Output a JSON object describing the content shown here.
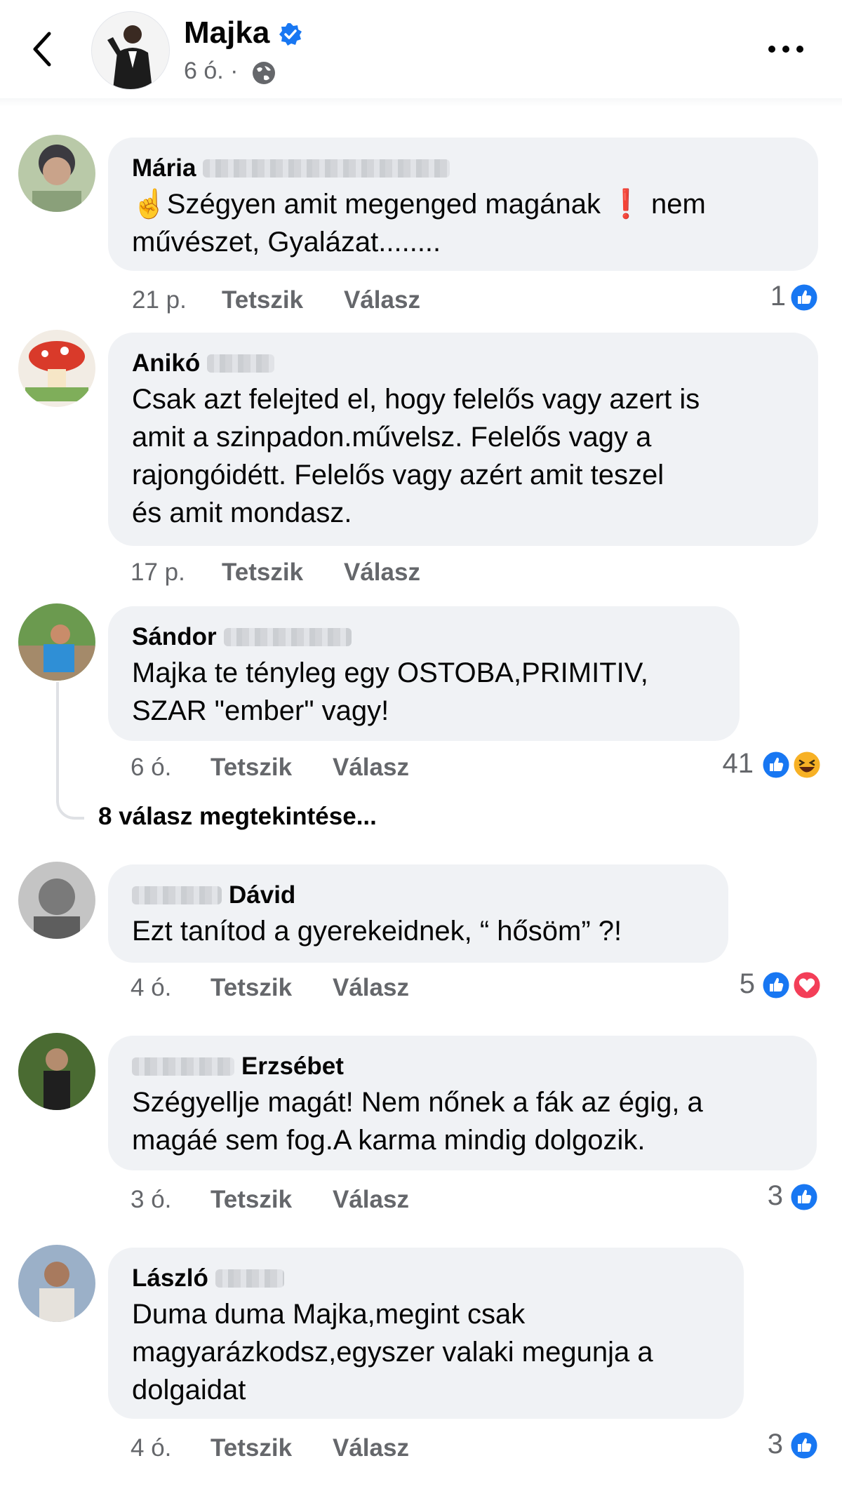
{
  "header": {
    "page_name": "Majka",
    "post_time": "6 ó. ·"
  },
  "comments": [
    {
      "first_name": "Mária",
      "text": "☝️Szégyen amit megenged magának ❗ nem\nművészet, Gyalázat........",
      "time": "21 p.",
      "like": "Tetszik",
      "reply": "Válasz",
      "reactions": "1"
    },
    {
      "first_name": "Anikó",
      "text": "Csak azt felejted el, hogy felelős vagy azert is\namit a szinpadon.művelsz. Felelős vagy a\nrajongóidétt. Felelős vagy azért amit teszel\nés amit mondasz.",
      "time": "17 p.",
      "like": "Tetszik",
      "reply": "Válasz",
      "reactions": ""
    },
    {
      "first_name": "Sándor",
      "text": "Majka te tényleg egy OSTOBA,PRIMITIV,\nSZAR \"ember\" vagy!",
      "time": "6 ó.",
      "like": "Tetszik",
      "reply": "Válasz",
      "reactions": "41",
      "replies_link": "8 válasz megtekintése..."
    },
    {
      "last_name": "Dávid",
      "text": "Ezt tanítod a gyerekeidnek, “ hősöm” ?!",
      "time": "4 ó.",
      "like": "Tetszik",
      "reply": "Válasz",
      "reactions": "5"
    },
    {
      "last_name": "Erzsébet",
      "text": "Szégyellje magát! Nem nőnek a fák az égig, a\nmagáé sem fog.A karma mindig dolgozik.",
      "time": "3 ó.",
      "like": "Tetszik",
      "reply": "Válasz",
      "reactions": "3"
    },
    {
      "first_name": "László",
      "text": "Duma duma Majka,megint csak\nmagyarázkodsz,egyszer valaki megunja a\ndolgaidat",
      "time": "4 ó.",
      "like": "Tetszik",
      "reply": "Válasz",
      "reactions": "3"
    }
  ],
  "colors": {
    "like_blue": "#1877f2",
    "love_red": "#f33e58",
    "haha_yellow": "#f7b125",
    "bubble": "#f0f2f5",
    "muted": "#65676b"
  },
  "icons": [
    "back-arrow-icon",
    "verified-badge-icon",
    "globe-icon",
    "more-options-icon",
    "like-reaction-icon",
    "love-reaction-icon",
    "haha-reaction-icon"
  ]
}
